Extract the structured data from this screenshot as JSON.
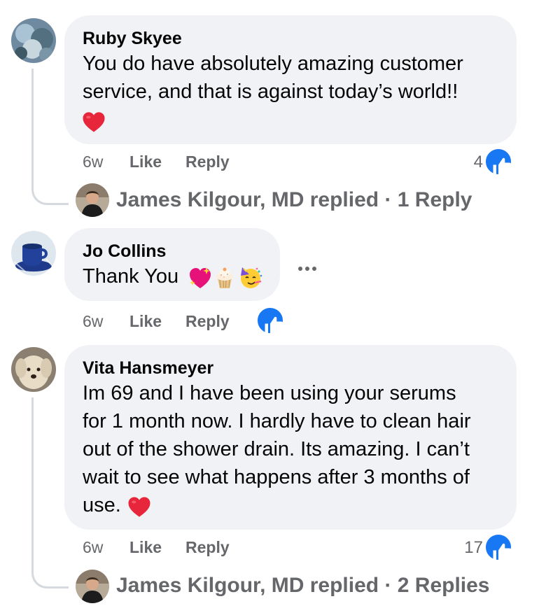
{
  "comments": [
    {
      "author": "Ruby Skyee",
      "line1": "You do have absolutely amazing customer",
      "line2": "service, and that is against today’s world!!",
      "time": "6w",
      "like_label": "Like",
      "reply_label": "Reply",
      "reaction_count": "4",
      "replied_text": "James Kilgour, MD replied · 1 Reply"
    },
    {
      "author": "Jo Collins",
      "text": "Thank You",
      "time": "6w",
      "like_label": "Like",
      "reply_label": "Reply"
    },
    {
      "author": "Vita Hansmeyer",
      "lines": [
        "Im 69 and I have been using your serums",
        "for 1 month now. I hardly have to clean hair",
        "out of the shower drain. Its amazing. I can’t",
        "wait to see what happens after 3 months of",
        "use."
      ],
      "time": "6w",
      "like_label": "Like",
      "reply_label": "Reply",
      "reaction_count": "17",
      "replied_text": "James Kilgour, MD replied · 2 Replies"
    }
  ],
  "colors": {
    "bubble": "#f0f2f5",
    "meta": "#65676b",
    "like_blue": "#1877f2",
    "heart": "#e8263b"
  },
  "icons": [
    "heart-emoji",
    "sparkling-heart-emoji",
    "cupcake-emoji",
    "partying-face-emoji",
    "thumbs-up-icon",
    "more-options-icon"
  ]
}
